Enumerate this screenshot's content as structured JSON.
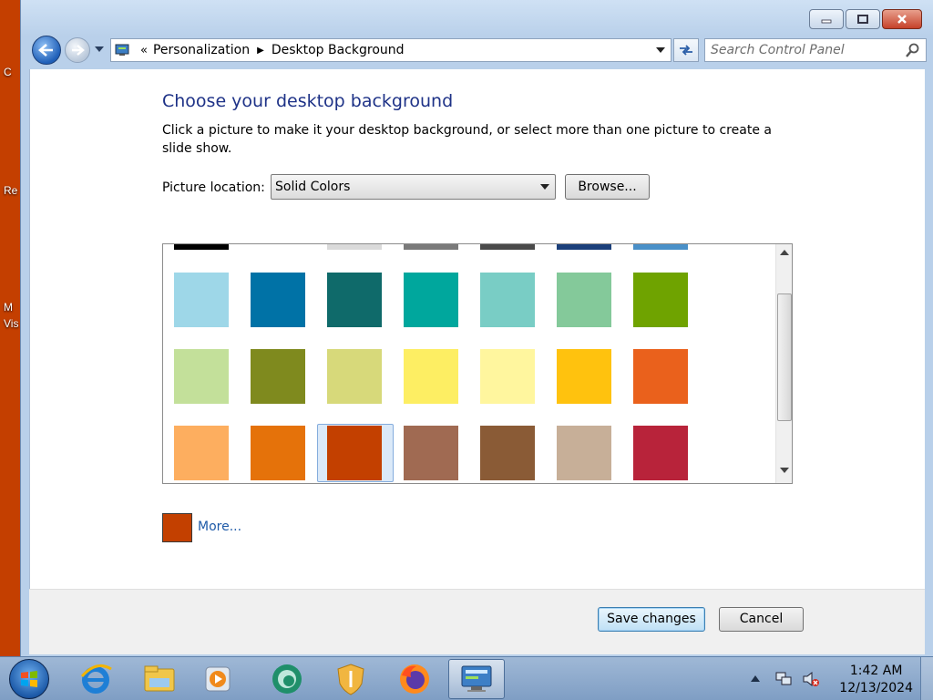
{
  "desktop": {
    "fragments": [
      "C",
      "Re",
      "M",
      "Vis"
    ]
  },
  "window": {
    "nav": {
      "breadcrumb": [
        "Personalization",
        "Desktop Background"
      ],
      "search_placeholder": "Search Control Panel"
    },
    "content": {
      "title": "Choose your desktop background",
      "description": "Click a picture to make it your desktop background, or select more than one picture to create a slide show.",
      "location_label": "Picture location:",
      "location_value": "Solid Colors",
      "browse_label": "Browse...",
      "more_label": "More...",
      "selected_color": "#c34000",
      "swatch_rows": [
        [
          "#000000",
          null,
          "#dadada",
          "#7a7a7a",
          "#4a4a4a",
          "#1b3f7a",
          "#4a90c8"
        ],
        [
          "#9ed7e8",
          "#0072a6",
          "#0f6a6a",
          "#00a79d",
          "#79cdc5",
          "#84c99a",
          "#6fa300"
        ],
        [
          "#c3e09a",
          "#7f8a1e",
          "#d7d97a",
          "#fdee63",
          "#fff69e",
          "#ffc20e",
          "#ea611c"
        ],
        [
          "#fdae5f",
          "#e5720a",
          "#c34000",
          "#a06a52",
          "#8a5b36",
          "#c7af98",
          "#b8233a"
        ]
      ]
    },
    "footer": {
      "save_label": "Save changes",
      "cancel_label": "Cancel"
    }
  },
  "taskbar": {
    "items": [
      "start-button",
      "ie-icon",
      "explorer-icon",
      "media-player-icon",
      "chat-icon",
      "security-icon",
      "firefox-icon",
      "control-panel-icon"
    ],
    "clock": {
      "time": "1:42 AM",
      "date": "12/13/2024"
    }
  }
}
